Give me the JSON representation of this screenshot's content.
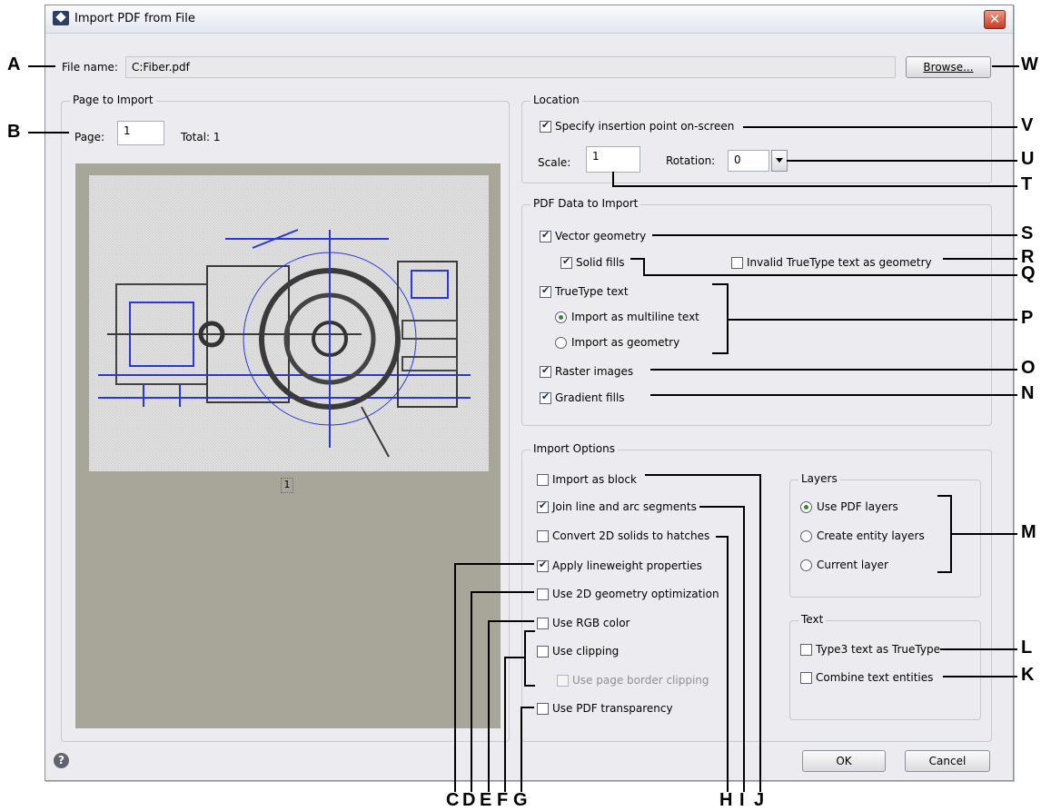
{
  "dialog": {
    "title": "Import PDF from File",
    "close_glyph": "✕",
    "file_name_label": "File name:",
    "file_name_value": "C:Fiber.pdf",
    "browse_label": "Browse...",
    "page_group": {
      "legend": "Page to Import",
      "page_label": "Page:",
      "page_value": "1",
      "total_label": "Total: 1",
      "page_number": "1"
    },
    "location": {
      "legend": "Location",
      "specify_label": "Specify insertion point on-screen",
      "specify_checked": true,
      "scale_label": "Scale:",
      "scale_value": "1",
      "rotation_label": "Rotation:",
      "rotation_value": "0"
    },
    "pdf_data": {
      "legend": "PDF Data to Import",
      "vector_geometry": "Vector geometry",
      "solid_fills": "Solid fills",
      "invalid_truetype": "Invalid TrueType text as geometry",
      "truetype_text": "TrueType text",
      "import_multiline": "Import as multiline text",
      "import_geometry": "Import as geometry",
      "raster_images": "Raster images",
      "gradient_fills": "Gradient fills"
    },
    "import_options": {
      "legend": "Import Options",
      "import_block": "Import as block",
      "join_segments": "Join line and arc segments",
      "convert_2d": "Convert 2D solids to hatches",
      "apply_lineweight": "Apply lineweight properties",
      "use_2d_opt": "Use 2D geometry optimization",
      "use_rgb": "Use RGB color",
      "use_clipping": "Use clipping",
      "use_page_border": "Use page border clipping",
      "use_transparency": "Use PDF transparency"
    },
    "layers": {
      "legend": "Layers",
      "use_pdf_layers": "Use PDF layers",
      "create_entity_layers": "Create entity layers",
      "current_layer": "Current layer"
    },
    "text": {
      "legend": "Text",
      "type3": "Type3 text as TrueType",
      "combine": "Combine text entities"
    },
    "ok_label": "OK",
    "cancel_label": "Cancel",
    "help_glyph": "?"
  },
  "callouts": {
    "A": "A",
    "B": "B",
    "C": "C",
    "D": "D",
    "E": "E",
    "F": "F",
    "G": "G",
    "H": "H",
    "I": "I",
    "J": "J",
    "K": "K",
    "L": "L",
    "M": "M",
    "N": "N",
    "O": "O",
    "P": "P",
    "Q": "Q",
    "R": "R",
    "S": "S",
    "T": "T",
    "U": "U",
    "V": "V",
    "W": "W"
  },
  "colors": {
    "drawing_lines": "#2a36d8",
    "drawing_dark": "#3a3a3a",
    "preview_bg": "#a8a698"
  },
  "icons": [
    "app-icon",
    "close-icon",
    "help-icon",
    "chevron-down-icon"
  ]
}
